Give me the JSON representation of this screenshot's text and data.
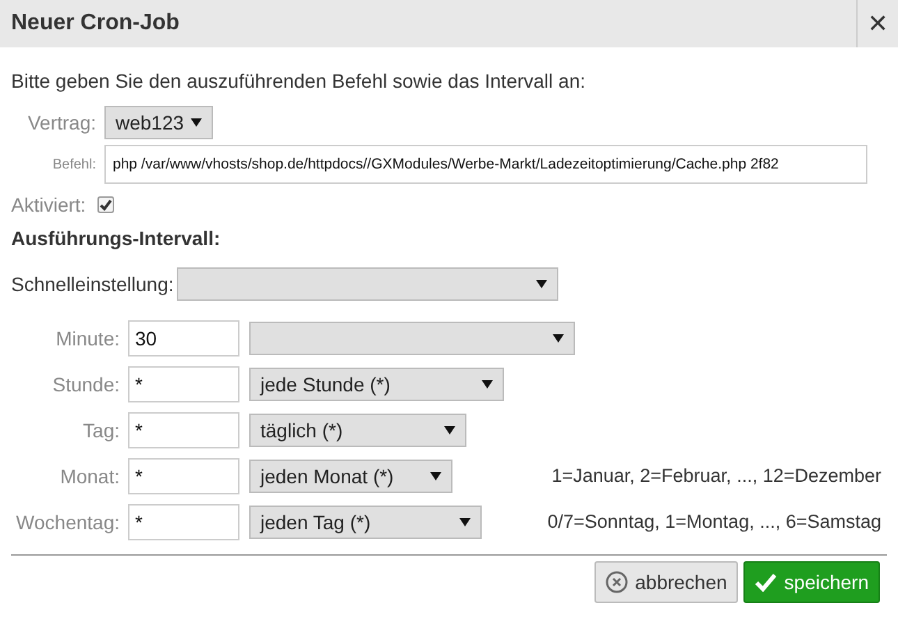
{
  "window": {
    "title": "Neuer Cron-Job",
    "close": "✕"
  },
  "intro": "Bitte geben Sie den auszuführenden Befehl sowie das Intervall an:",
  "contract": {
    "label": "Vertrag:",
    "value": "web123"
  },
  "command": {
    "label": "Befehl:",
    "value": "php /var/www/vhosts/shop.de/httpdocs//GXModules/Werbe-Markt/Ladezeitoptimierung/Cache.php 2f82"
  },
  "active": {
    "label": "Aktiviert:",
    "checked": true
  },
  "section_heading": "Ausführungs-Intervall:",
  "quick_setting": {
    "label": "Schnelleinstellung:"
  },
  "fields": [
    {
      "label": "Minute:",
      "value": "30"
    },
    {
      "label": "Stunde:",
      "value": "*",
      "select": "jede Stunde (*)"
    },
    {
      "label": "Tag:",
      "value": "*",
      "select": "täglich (*)"
    },
    {
      "label": "Monat:",
      "value": "*",
      "select": "jeden Monat (*)",
      "hint": "1=Januar, 2=Februar, ..., 12=Dezember"
    },
    {
      "label": "Wochentag:",
      "value": "*",
      "select": "jeden Tag (*)",
      "hint": "0/7=Sonntag, 1=Montag, ..., 6=Samstag"
    }
  ],
  "buttons": [
    {
      "kind": "cancel",
      "label": "abbrechen"
    },
    {
      "kind": "save",
      "label": "speichern"
    }
  ]
}
